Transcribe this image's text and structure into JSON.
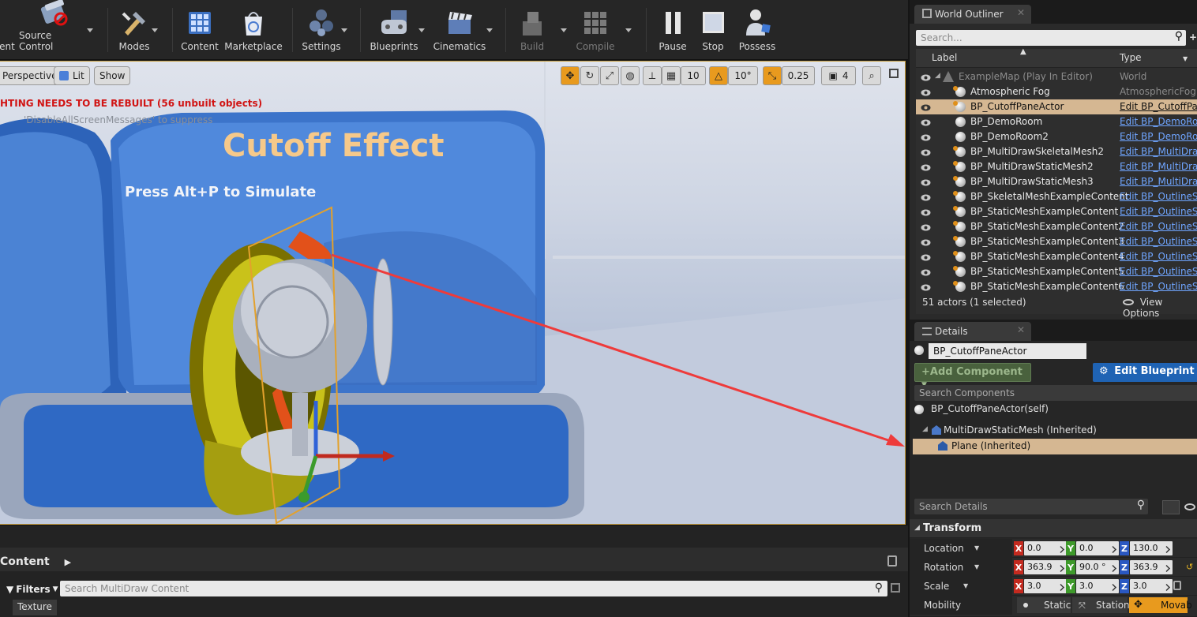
{
  "toolbar": {
    "items": [
      {
        "label": "ent",
        "icon": "save-icon"
      },
      {
        "label": "Source Control",
        "icon": "source-control-icon"
      },
      {
        "label": "Modes",
        "icon": "modes-icon"
      },
      {
        "label": "Content",
        "icon": "content-icon"
      },
      {
        "label": "Marketplace",
        "icon": "marketplace-icon"
      },
      {
        "label": "Settings",
        "icon": "settings-icon"
      },
      {
        "label": "Blueprints",
        "icon": "blueprints-icon"
      },
      {
        "label": "Cinematics",
        "icon": "cinematics-icon"
      },
      {
        "label": "Build",
        "icon": "build-icon"
      },
      {
        "label": "Compile",
        "icon": "compile-icon"
      },
      {
        "label": "Pause",
        "icon": "pause-icon"
      },
      {
        "label": "Stop",
        "icon": "stop-icon"
      },
      {
        "label": "Possess",
        "icon": "possess-icon"
      }
    ]
  },
  "viewport": {
    "perspective_label": "Perspective",
    "lit_label": "Lit",
    "show_label": "Show",
    "grid_snap": "10",
    "rotation_snap": "10°",
    "scale_snap": "0.25",
    "camera_speed": "4",
    "warning": "HTING NEEDS TO BE REBUILT (56 unbuilt objects)",
    "warning_sub": "'DisableAllScreenMessages' to suppress",
    "scene_title": "Cutoff Effect",
    "scene_hint": "Press Alt+P to Simulate"
  },
  "content_browser": {
    "title": "Content",
    "filters_label": "Filters",
    "search_placeholder": "Search MultiDraw Content",
    "filter_tag": "Texture"
  },
  "outliner": {
    "tab_label": "World Outliner",
    "search_placeholder": "Search...",
    "col_label": "Label",
    "col_type": "Type",
    "rows": [
      {
        "label": "ExampleMap (Play In Editor)",
        "type": "World"
      },
      {
        "label": "Atmospheric Fog",
        "type": "AtmosphericFog"
      },
      {
        "label": "BP_CutoffPaneActor",
        "type": "Edit BP_CutoffPa"
      },
      {
        "label": "BP_DemoRoom",
        "type": "Edit BP_DemoRo"
      },
      {
        "label": "BP_DemoRoom2",
        "type": "Edit BP_DemoRo"
      },
      {
        "label": "BP_MultiDrawSkeletalMesh2",
        "type": "Edit BP_MultiDra"
      },
      {
        "label": "BP_MultiDrawStaticMesh2",
        "type": "Edit BP_MultiDra"
      },
      {
        "label": "BP_MultiDrawStaticMesh3",
        "type": "Edit BP_MultiDra"
      },
      {
        "label": "BP_SkeletalMeshExampleContent",
        "type": "Edit BP_OutlineS"
      },
      {
        "label": "BP_StaticMeshExampleContent",
        "type": "Edit BP_OutlineS"
      },
      {
        "label": "BP_StaticMeshExampleContent2",
        "type": "Edit BP_OutlineS"
      },
      {
        "label": "BP_StaticMeshExampleContent3",
        "type": "Edit BP_OutlineS"
      },
      {
        "label": "BP_StaticMeshExampleContent4",
        "type": "Edit BP_OutlineS"
      },
      {
        "label": "BP_StaticMeshExampleContent5",
        "type": "Edit BP_OutlineS"
      },
      {
        "label": "BP_StaticMeshExampleContent6",
        "type": "Edit BP_OutlineS"
      }
    ],
    "footer_count": "51 actors (1 selected)",
    "view_options": "View Options"
  },
  "details": {
    "tab_label": "Details",
    "actor_name": "BP_CutoffPaneActor",
    "add_component": "+Add Component",
    "edit_blueprint": "Edit Blueprint",
    "search_components_placeholder": "Search Components",
    "components": [
      {
        "label": "BP_CutoffPaneActor(self)"
      },
      {
        "label": "MultiDrawStaticMesh (Inherited)"
      },
      {
        "label": "Plane (Inherited)"
      }
    ],
    "search_details_placeholder": "Search Details",
    "transform_label": "Transform",
    "location": {
      "label": "Location",
      "x": "0.0",
      "y": "0.0",
      "z": "130.0"
    },
    "rotation": {
      "label": "Rotation",
      "x": "363.9",
      "y": "90.0 °",
      "z": "363.9"
    },
    "scale": {
      "label": "Scale",
      "x": "3.0",
      "y": "3.0",
      "z": "3.0"
    },
    "mobility": {
      "label": "Mobility",
      "options": [
        "Static",
        "Station",
        "Movab"
      ]
    }
  }
}
